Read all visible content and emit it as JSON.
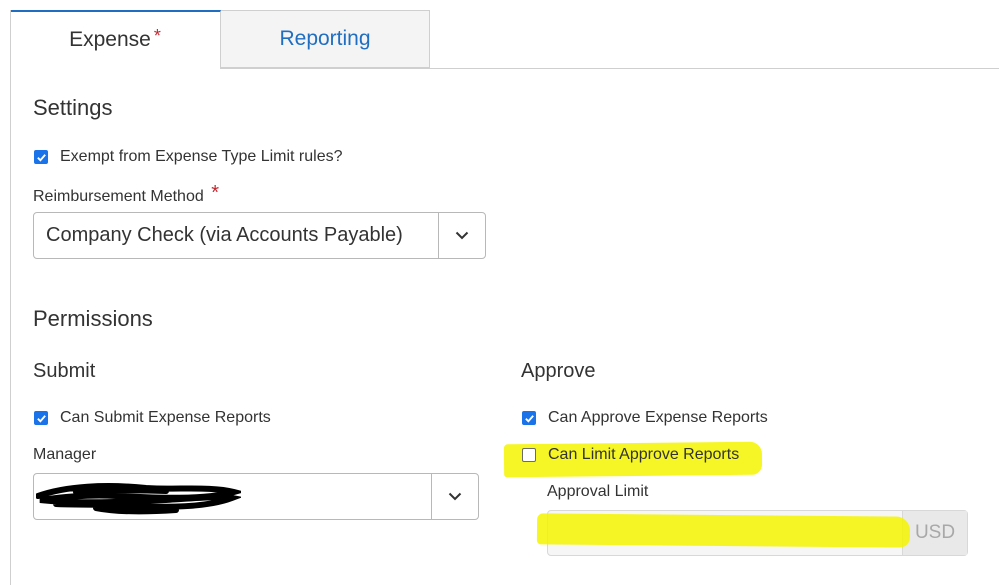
{
  "tabs": [
    {
      "label": "Expense",
      "required_mark": "*",
      "active": true
    },
    {
      "label": "Reporting",
      "active": false
    }
  ],
  "settings": {
    "heading": "Settings",
    "exempt": {
      "label": "Exempt from Expense Type Limit rules?",
      "checked": true
    },
    "reimbursement": {
      "label": "Reimbursement Method",
      "required_mark": "*",
      "value": "Company Check (via Accounts Payable)"
    }
  },
  "permissions": {
    "heading": "Permissions",
    "submit": {
      "heading": "Submit",
      "can_submit": {
        "label": "Can Submit Expense Reports",
        "checked": true
      },
      "manager": {
        "label": "Manager",
        "value": ""
      }
    },
    "approve": {
      "heading": "Approve",
      "can_approve": {
        "label": "Can Approve Expense Reports",
        "checked": true
      },
      "can_limit": {
        "label": "Can Limit Approve Reports",
        "checked": false
      },
      "approval_limit": {
        "label": "Approval Limit",
        "value": "",
        "currency": "USD"
      }
    }
  },
  "colors": {
    "accent": "#1f6ec2",
    "checkbox": "#1a73e8",
    "required": "#c4262e",
    "highlight": "#f4f400"
  },
  "icons": {
    "select_caret": "chevron-down-icon",
    "checkbox_tick": "check-icon"
  }
}
